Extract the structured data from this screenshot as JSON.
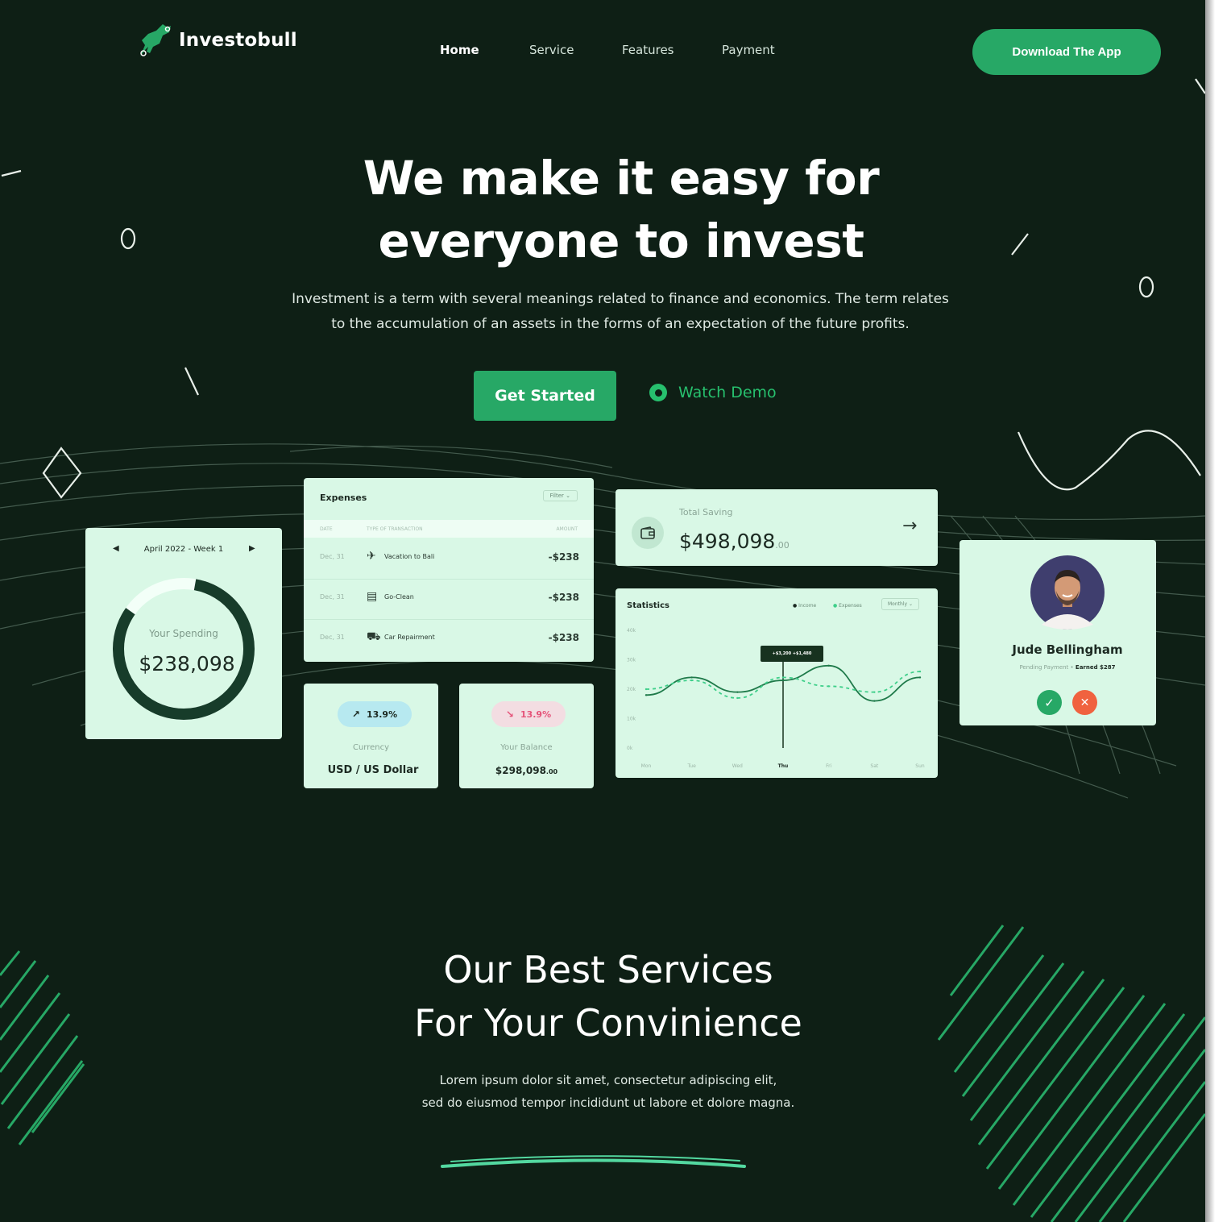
{
  "brand": {
    "name": "Investobull",
    "accent": "#27a866",
    "background": "#0e1f15",
    "card_bg": "#d9f8e6"
  },
  "nav": {
    "items": [
      "Home",
      "Service",
      "Features",
      "Payment"
    ],
    "cta": "Download The App"
  },
  "hero": {
    "title_line1": "We make it easy for",
    "title_line2": "everyone to invest",
    "subtitle_line1": "Investment is a term with several meanings related to finance and economics. The term relates",
    "subtitle_line2": "to the accumulation of an assets in the forms of an expectation of the future profits.",
    "primary_button": "Get Started",
    "secondary_button": "Watch Demo"
  },
  "spending_card": {
    "period": "April 2022 - Week 1",
    "label": "Your Spending",
    "amount": "$238,098",
    "progress_fraction": 0.82
  },
  "expenses_card": {
    "title": "Expenses",
    "filter": "Filter",
    "columns": [
      "DATE",
      "TYPE OF TRANSACTION",
      "AMOUNT"
    ],
    "rows": [
      {
        "date": "Dec, 31",
        "icon": "plane-icon",
        "name": "Vacation to Bali",
        "amount": "-$238"
      },
      {
        "date": "Dec, 31",
        "icon": "cabinet-icon",
        "name": "Go-Clean",
        "amount": "-$238"
      },
      {
        "date": "Dec, 31",
        "icon": "car-icon",
        "name": "Car Repairment",
        "amount": "-$238"
      }
    ]
  },
  "currency_card": {
    "change": "13.9%",
    "trend": "up",
    "label": "Currency",
    "value": "USD / US Dollar"
  },
  "balance_card": {
    "change": "13.9%",
    "trend": "down",
    "label": "Your Balance",
    "value_main": "$298,098",
    "value_cents": ".00"
  },
  "saving_card": {
    "label": "Total Saving",
    "amount_main": "$498,098",
    "amount_cents": ".00"
  },
  "statistics_card": {
    "title": "Statistics",
    "legend": [
      "Income",
      "Expenses"
    ],
    "period": "Monthly",
    "tooltip": "+$3,200 +$1,480",
    "y_ticks": [
      "40k",
      "30k",
      "20k",
      "10k",
      "0k"
    ],
    "active_day": "Thu"
  },
  "chart_data": {
    "type": "line",
    "x": [
      "Mon",
      "Tue",
      "Wed",
      "Thu",
      "Fri",
      "Sat",
      "Sun"
    ],
    "ylim": [
      0,
      40
    ],
    "series": [
      {
        "name": "Income",
        "values": [
          18,
          24,
          19,
          23,
          28,
          16,
          24
        ]
      },
      {
        "name": "Expenses",
        "values": [
          20,
          23,
          17,
          24,
          21,
          19,
          26
        ]
      }
    ]
  },
  "profile_card": {
    "name": "Jude Bellingham",
    "status_label": "Pending Payment",
    "earned": "Earned $287"
  },
  "services": {
    "title_line1": "Our Best Services",
    "title_line2": "For Your Convinience",
    "subtitle_line1": "Lorem ipsum dolor sit amet, consectetur adipiscing elit,",
    "subtitle_line2": "sed do eiusmod tempor incididunt ut labore et dolore magna."
  }
}
